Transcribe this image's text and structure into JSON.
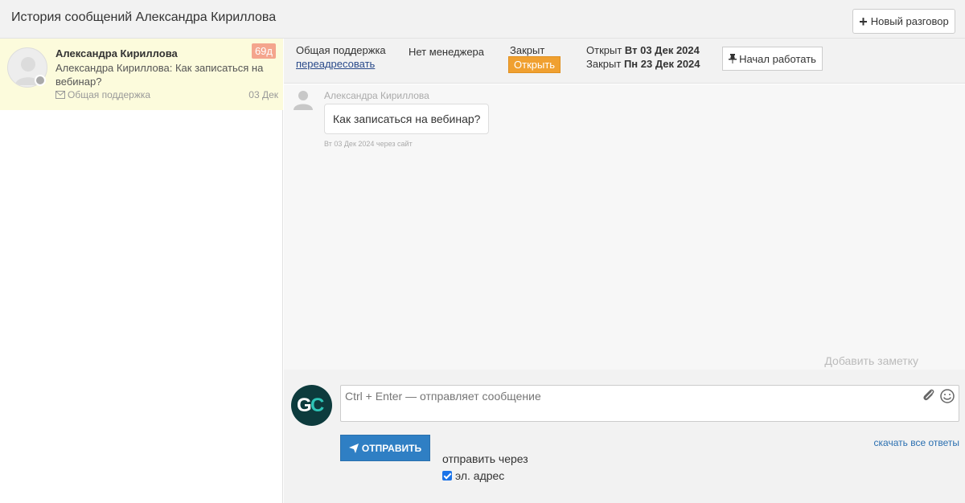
{
  "header": {
    "title": "История сообщений Александра Кириллова",
    "new_button_label": "Новый разговор"
  },
  "sidebar": {
    "conversations": [
      {
        "name": "Александра Кириллова",
        "preview": "Александра Кириллова: Как записаться на вебинар?",
        "channel": "Общая поддержка",
        "date": "03 Дек",
        "age_badge": "69д"
      }
    ]
  },
  "info_bar": {
    "department": "Общая поддержка",
    "reassign_label": "переадресовать",
    "manager": "Нет менеджера",
    "state": "Закрыт",
    "open_button_label": "Открыть",
    "opened_label": "Открыт",
    "opened_date": "Вт 03 Дек 2024",
    "closed_label": "Закрыт",
    "closed_date": "Пн 23 Дек 2024",
    "start_button_label": "Начал работать"
  },
  "messages": [
    {
      "author": "Александра Кириллова",
      "text": "Как записаться на вебинар?",
      "meta": "Вт 03 Дек 2024 через сайт"
    }
  ],
  "add_note_label": "Добавить заметку",
  "composer": {
    "logo_text_g": "G",
    "logo_text_c": "C",
    "placeholder": "Ctrl + Enter — отправляет сообщение",
    "send_button_label": "ОТПРАВИТЬ",
    "download_link": "скачать все ответы",
    "send_via_label": "отправить через",
    "email_option_label": "эл. адрес"
  },
  "colors": {
    "selected_conversation_bg": "#fcfbdc",
    "age_badge": "#f4a58d",
    "open_button": "#f0a030",
    "send_button": "#2f7fc4",
    "logo_bg": "#0d3b3d",
    "logo_g": "#ffffff",
    "logo_c": "#2ec4b6"
  }
}
